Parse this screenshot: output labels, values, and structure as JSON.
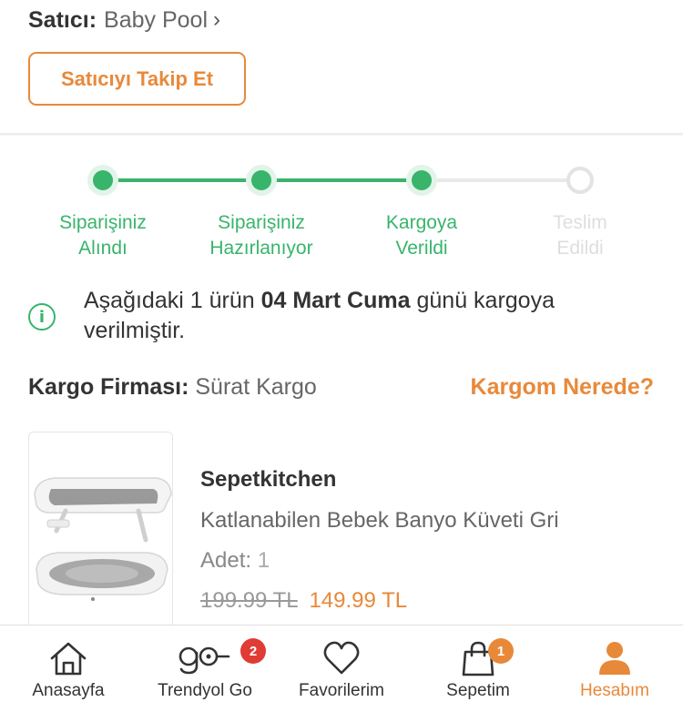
{
  "seller": {
    "label": "Satıcı:",
    "name": "Baby Pool",
    "chevron": "›"
  },
  "follow_button": "Satıcıyı Takip Et",
  "tracking": {
    "steps": [
      {
        "line1": "Siparişiniz",
        "line2": "Alındı",
        "done": true
      },
      {
        "line1": "Siparişiniz",
        "line2": "Hazırlanıyor",
        "done": true
      },
      {
        "line1": "Kargoya",
        "line2": "Verildi",
        "done": true
      },
      {
        "line1": "Teslim",
        "line2": "Edildi",
        "done": false
      }
    ],
    "accent_done": "#38b46b",
    "accent_todo": "#dedede"
  },
  "info": {
    "icon": "info-circle-icon",
    "text_before": "Aşağıdaki 1 ürün ",
    "text_bold": "04 Mart Cuma",
    "text_after": " günü kargoya verilmiştir."
  },
  "cargo": {
    "label": "Kargo Firması:",
    "value": " Sürat Kargo",
    "link": "Kargom Nerede?"
  },
  "product": {
    "brand": "Sepetkitchen",
    "name": "Katlanabilen Bebek Banyo Küveti Gri",
    "qty_label": "Adet:",
    "qty_value": " 1",
    "old_price": "199.99 TL",
    "new_price": "149.99 TL"
  },
  "tabbar": {
    "items": [
      {
        "label": "Anasayfa",
        "icon": "home-icon"
      },
      {
        "label": "Trendyol Go",
        "icon": "trendyol-go-icon",
        "badge": "2"
      },
      {
        "label": "Favorilerim",
        "icon": "heart-icon"
      },
      {
        "label": "Sepetim",
        "icon": "shopping-bag-icon",
        "badge": "1"
      },
      {
        "label": "Hesabım",
        "icon": "user-icon",
        "active": true
      }
    ]
  },
  "colors": {
    "brand_orange": "#e8893a",
    "success_green": "#38b46b",
    "badge_red": "#e03b35"
  }
}
